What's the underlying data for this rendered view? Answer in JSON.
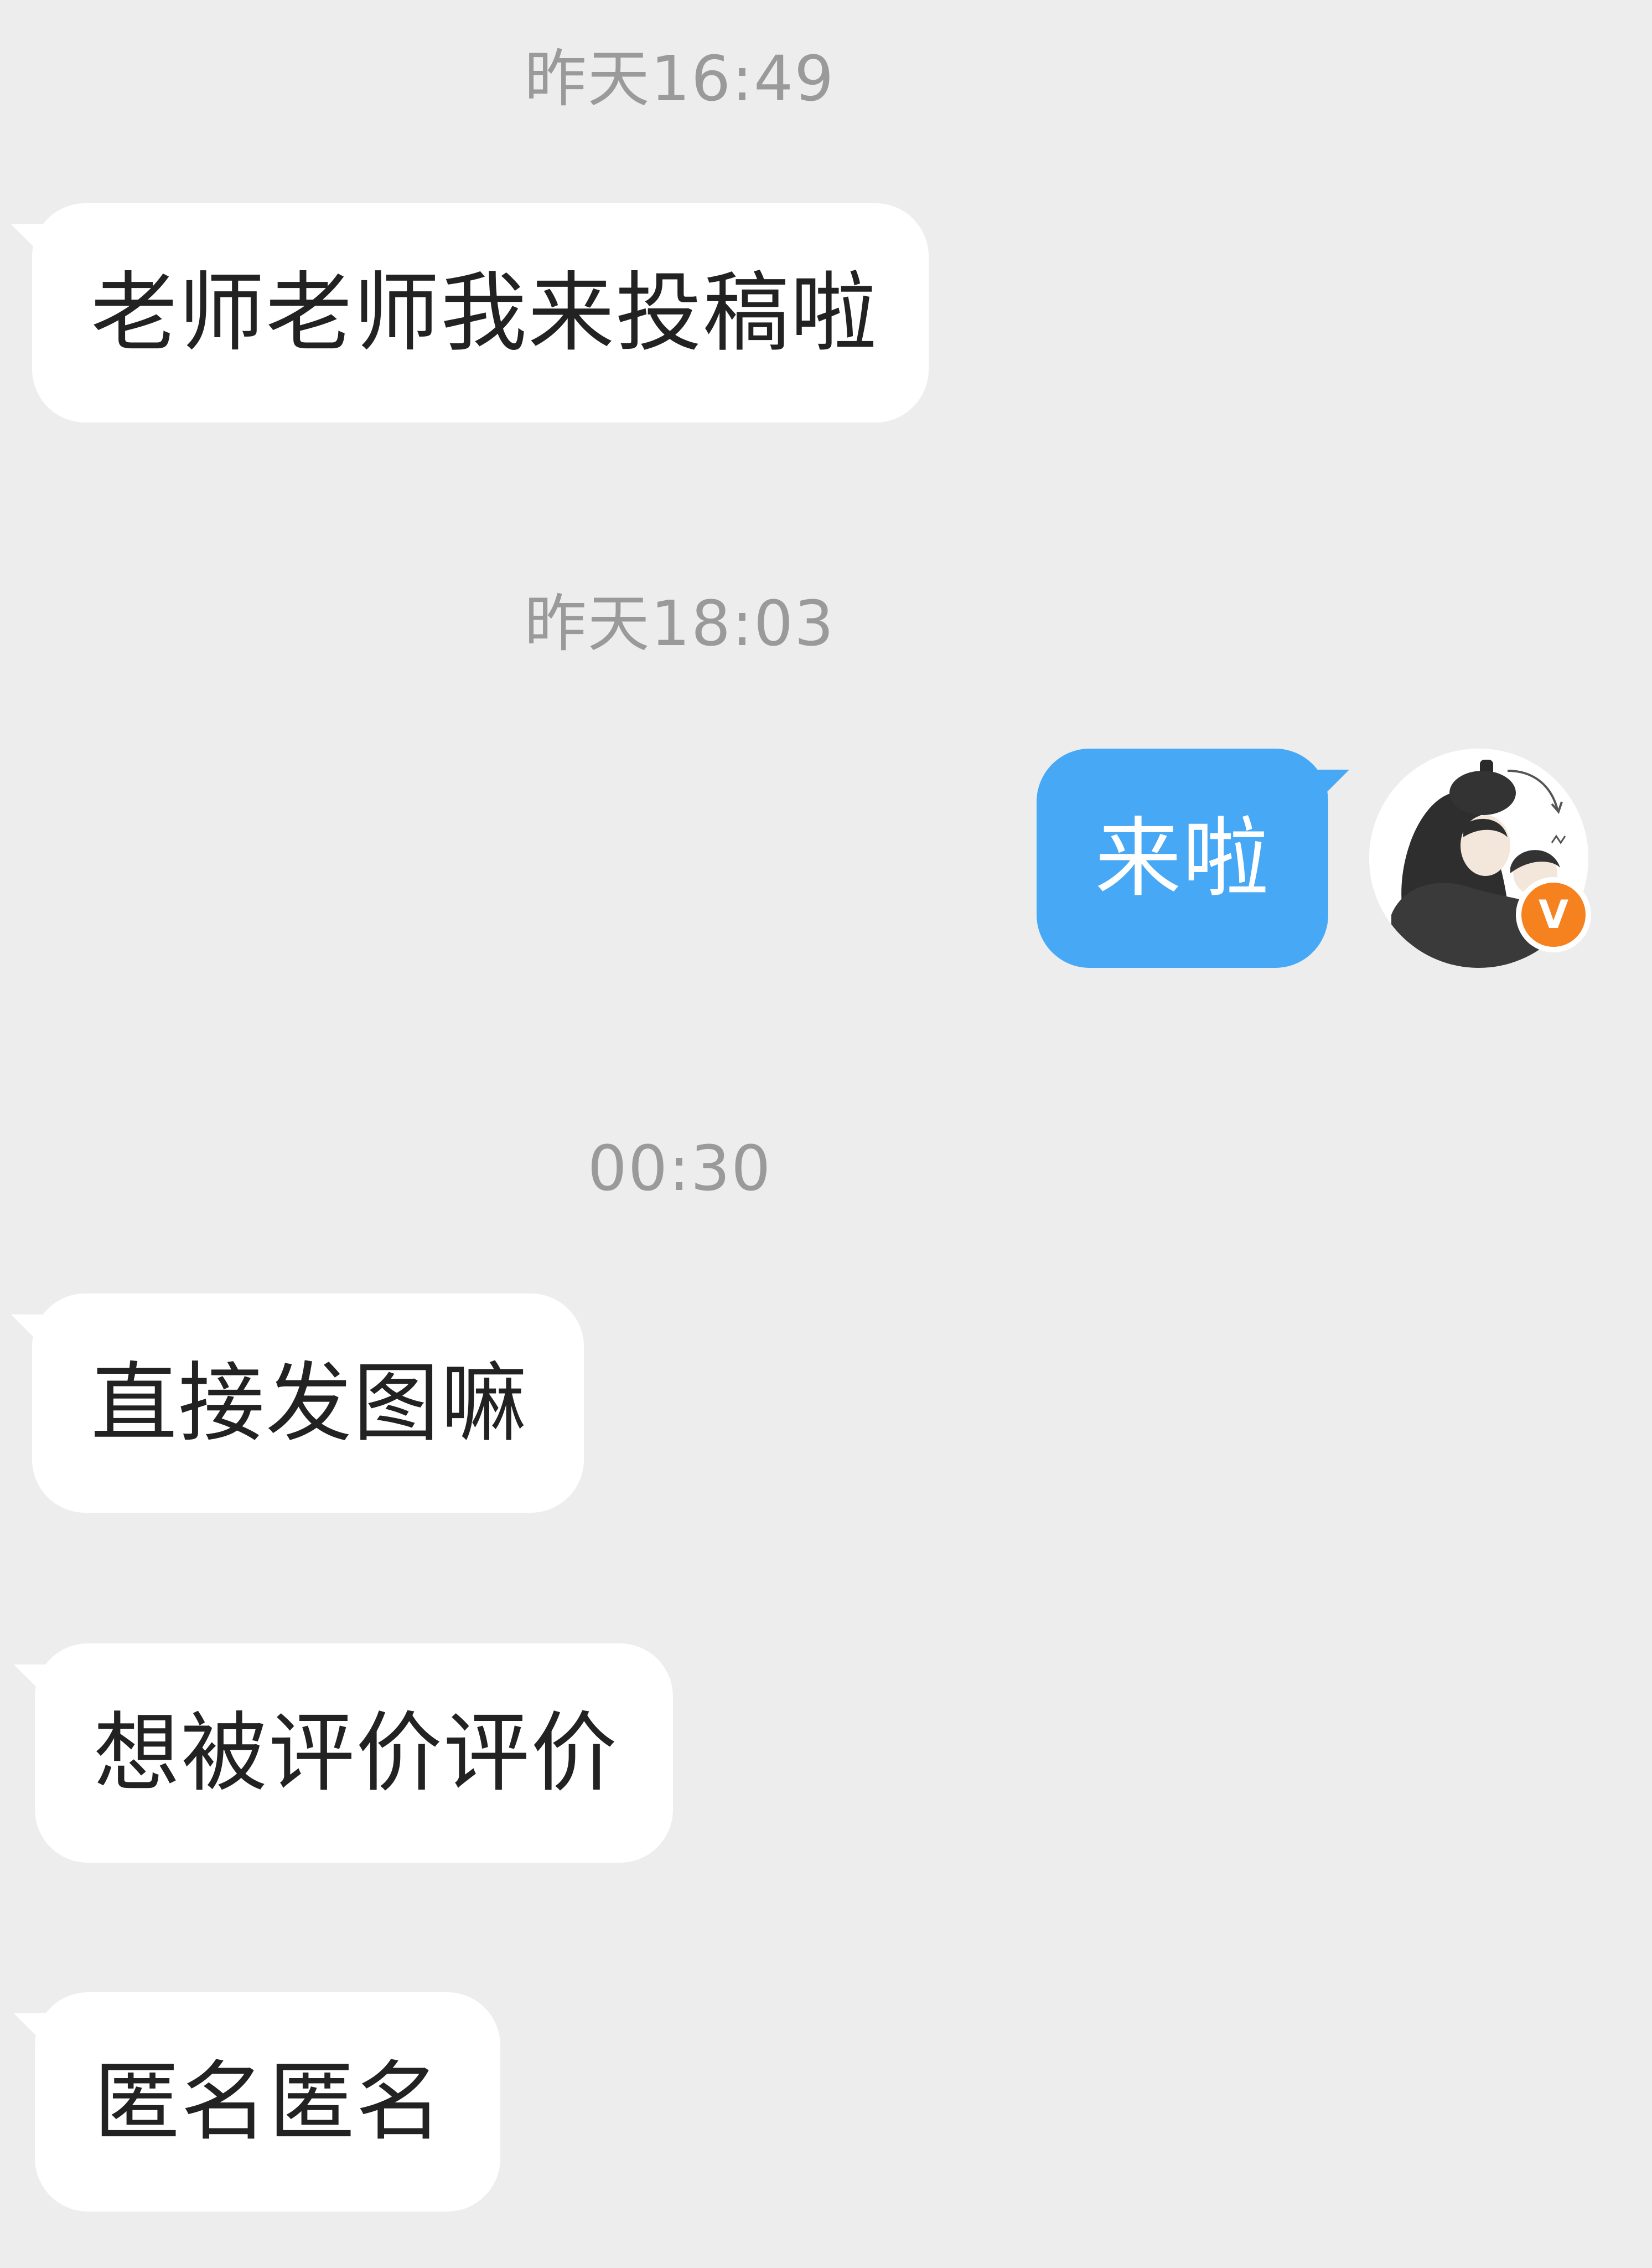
{
  "chat": {
    "timestamps": [
      "昨天16:49",
      "昨天18:03",
      "00:30"
    ],
    "messages": [
      {
        "direction": "incoming",
        "text": "老师老师我来投稿啦"
      },
      {
        "direction": "outgoing",
        "text": "来啦"
      },
      {
        "direction": "incoming",
        "text": "直接发图嘛"
      },
      {
        "direction": "incoming",
        "text": "想被评价评价"
      },
      {
        "direction": "incoming",
        "text": "匿名匿名"
      }
    ]
  },
  "avatar": {
    "badge_letter": "V",
    "badge_color": "#f5821f"
  },
  "colors": {
    "background": "#ededed",
    "incoming_bubble": "#ffffff",
    "outgoing_bubble": "#47a8f5",
    "timestamp_text": "#9a9a9a"
  }
}
